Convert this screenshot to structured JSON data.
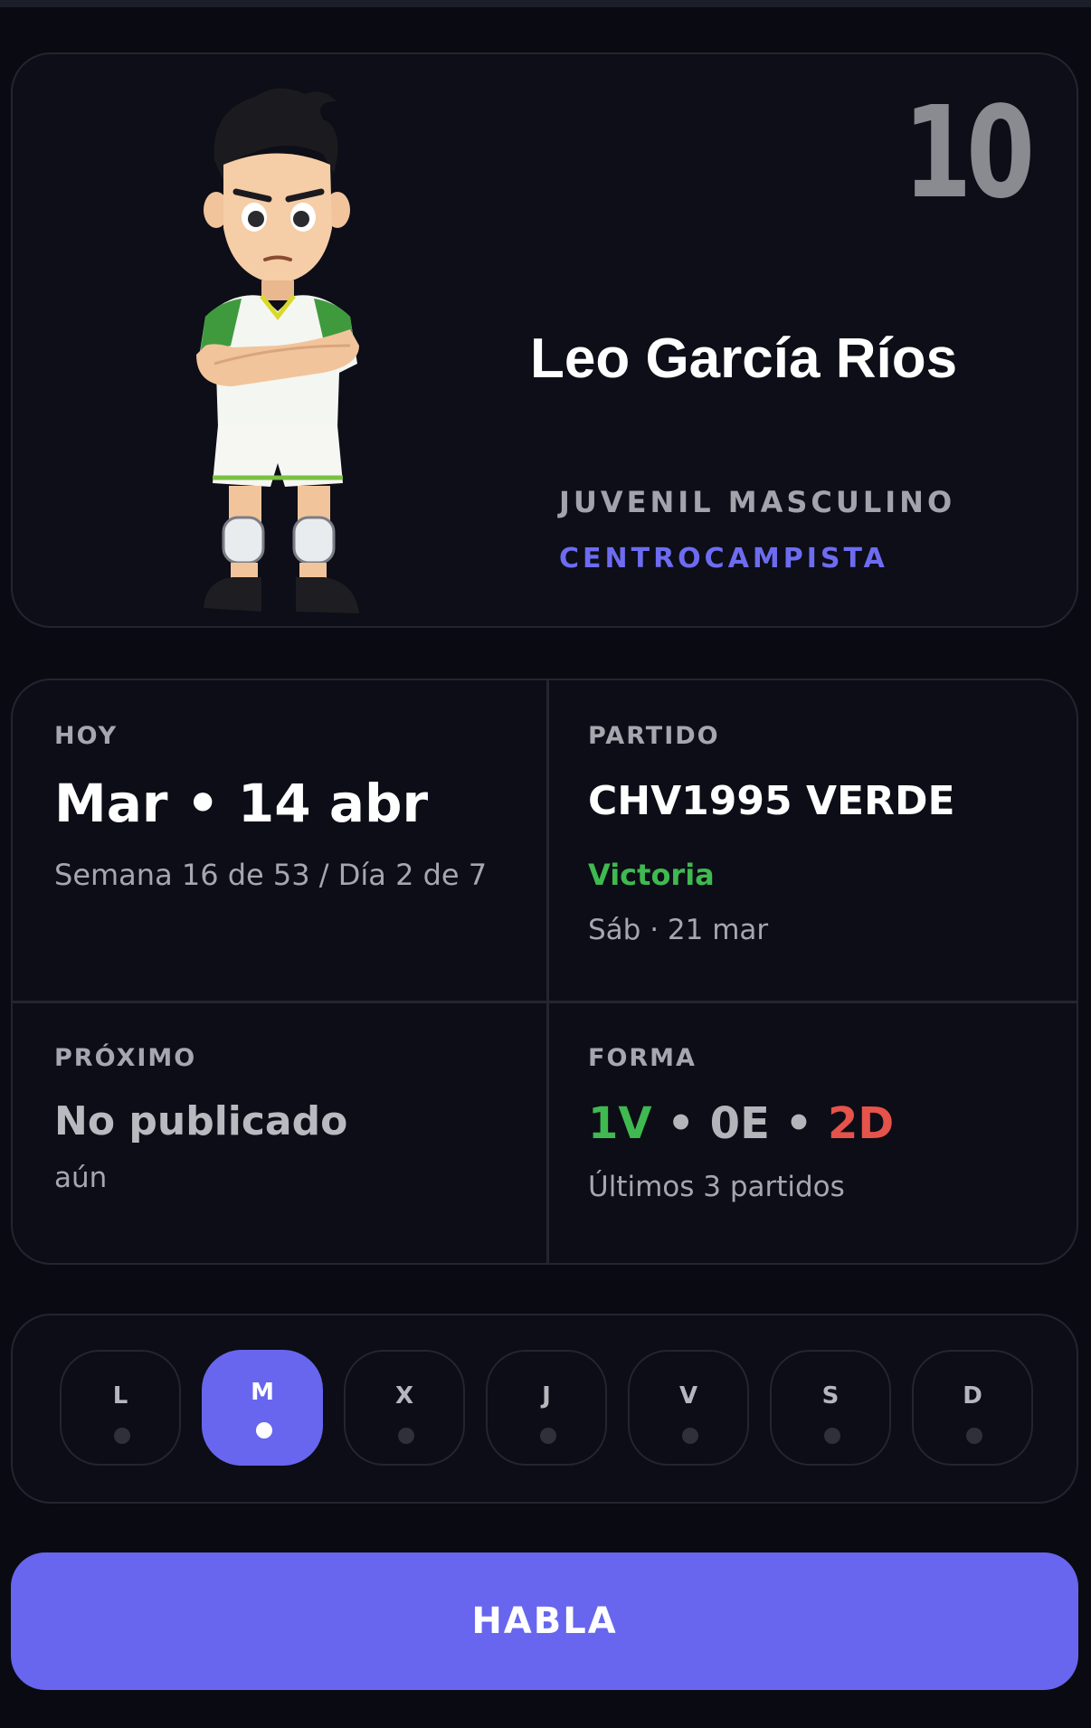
{
  "player": {
    "number": "10",
    "name": "Leo García Ríos",
    "category": "JUVENIL MASCULINO",
    "position": "CENTROCAMPISTA",
    "avatar_icon": "cartoon-footballer-avatar"
  },
  "today": {
    "label": "HOY",
    "date": "Mar • 14 abr",
    "week_info": "Semana 16 de 53 / Día 2 de 7"
  },
  "match": {
    "label": "PARTIDO",
    "team": "CHV1995 VERDE",
    "result": "Victoria",
    "date": "Sáb · 21 mar"
  },
  "next": {
    "label": "PRÓXIMO",
    "status": "No publicado",
    "sub": "aún"
  },
  "form": {
    "label": "FORMA",
    "wins": "1V",
    "draws": "0E",
    "losses": "2D",
    "separator": "•",
    "sub": "Últimos 3 partidos"
  },
  "week_days": [
    {
      "letter": "L",
      "active": false
    },
    {
      "letter": "M",
      "active": true
    },
    {
      "letter": "X",
      "active": false
    },
    {
      "letter": "J",
      "active": false
    },
    {
      "letter": "V",
      "active": false
    },
    {
      "letter": "S",
      "active": false
    },
    {
      "letter": "D",
      "active": false
    }
  ],
  "cta": {
    "label": "HABLA"
  },
  "colors": {
    "accent": "#6866ee",
    "win": "#3fb950",
    "loss": "#e5534b",
    "background": "#0a0b12"
  }
}
